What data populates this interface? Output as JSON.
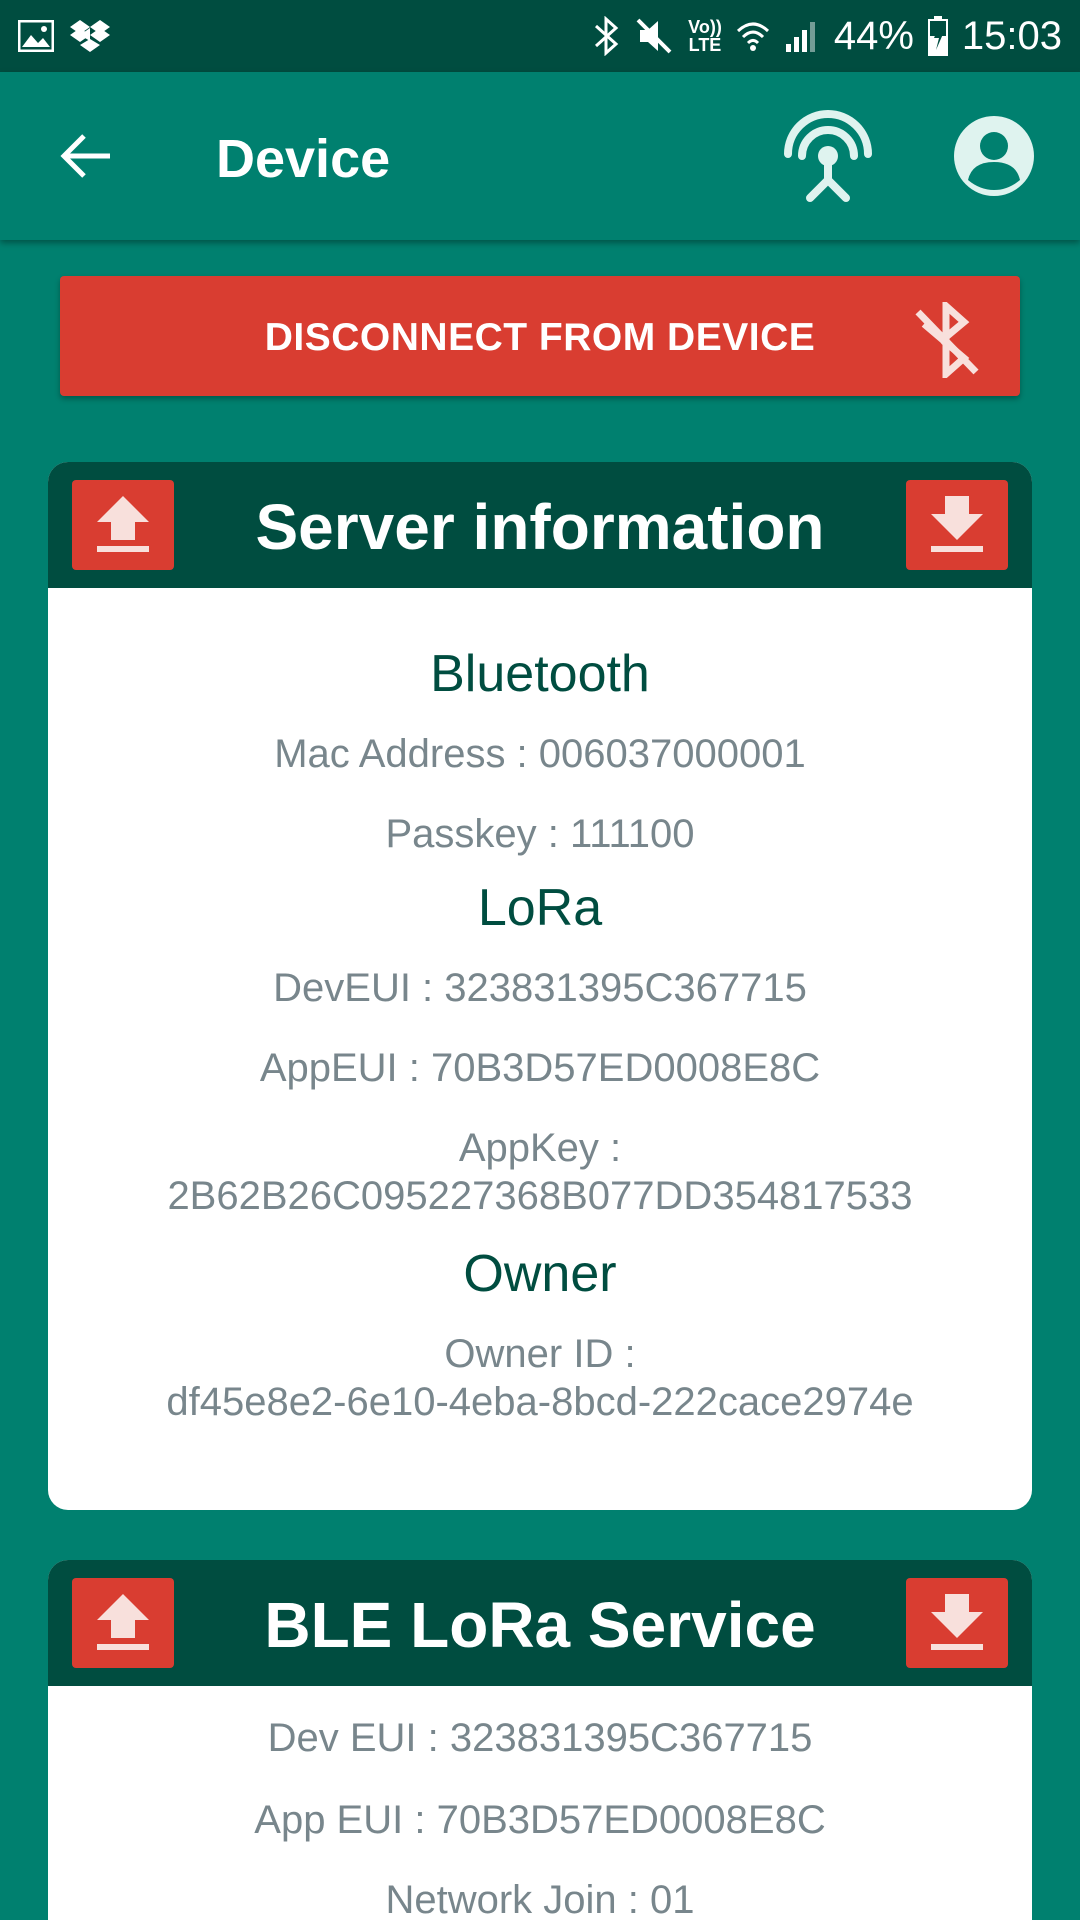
{
  "status_bar": {
    "battery": "44%",
    "time": "15:03",
    "volte_top": "Vo))",
    "volte_bottom": "LTE",
    "icons": [
      "image-icon",
      "dropbox-icon",
      "bluetooth-icon",
      "mute-icon",
      "volte-icon",
      "wifi-icon",
      "signal-icon",
      "battery-icon"
    ]
  },
  "app_bar": {
    "title": "Device",
    "icons": [
      "back-arrow-icon",
      "antenna-icon",
      "account-icon"
    ]
  },
  "disconnect": {
    "label": "DISCONNECT FROM DEVICE",
    "icon": "bluetooth-disabled-icon",
    "color": "#d93d31"
  },
  "server_card": {
    "title": "Server information",
    "upload_icon": "upload-icon",
    "download_icon": "download-icon",
    "bluetooth": {
      "heading": "Bluetooth",
      "mac": "Mac Address : 006037000001",
      "passkey": "Passkey : 111100"
    },
    "lora": {
      "heading": "LoRa",
      "deveui": "DevEUI : 323831395C367715",
      "appeui": "AppEUI : 70B3D57ED0008E8C",
      "appkey_label": "AppKey :",
      "appkey_value": "2B62B26C095227368B077DD354817533"
    },
    "owner": {
      "heading": "Owner",
      "id_label": "Owner ID :",
      "id_value": "df45e8e2-6e10-4eba-8bcd-222cace2974e"
    }
  },
  "ble_card": {
    "title": "BLE LoRa Service",
    "dev_eui": "Dev EUI : 323831395C367715",
    "app_eui": "App EUI : 70B3D57ED0008E8C",
    "network_join": "Network Join : 01"
  },
  "colors": {
    "primary": "#00806f",
    "primary_dark": "#004d40",
    "accent": "#d93d31",
    "text_secondary": "#78868c"
  }
}
